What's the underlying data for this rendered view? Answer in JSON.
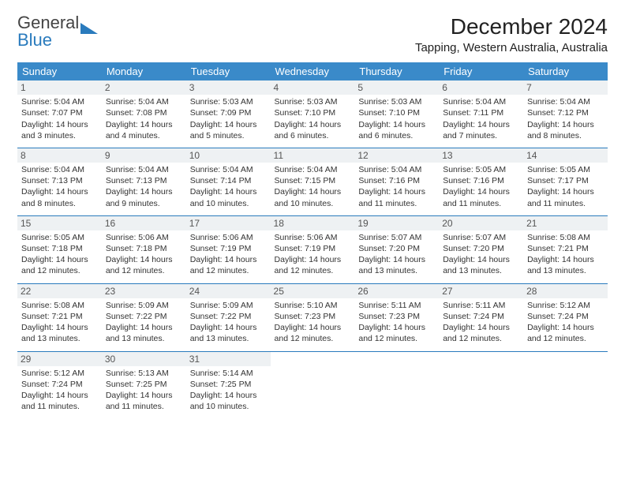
{
  "logo": {
    "part1": "General",
    "part2": "Blue"
  },
  "title": "December 2024",
  "location": "Tapping, Western Australia, Australia",
  "weekdays": [
    "Sunday",
    "Monday",
    "Tuesday",
    "Wednesday",
    "Thursday",
    "Friday",
    "Saturday"
  ],
  "weeks": [
    [
      {
        "n": "1",
        "sr": "Sunrise: 5:04 AM",
        "ss": "Sunset: 7:07 PM",
        "d1": "Daylight: 14 hours",
        "d2": "and 3 minutes."
      },
      {
        "n": "2",
        "sr": "Sunrise: 5:04 AM",
        "ss": "Sunset: 7:08 PM",
        "d1": "Daylight: 14 hours",
        "d2": "and 4 minutes."
      },
      {
        "n": "3",
        "sr": "Sunrise: 5:03 AM",
        "ss": "Sunset: 7:09 PM",
        "d1": "Daylight: 14 hours",
        "d2": "and 5 minutes."
      },
      {
        "n": "4",
        "sr": "Sunrise: 5:03 AM",
        "ss": "Sunset: 7:10 PM",
        "d1": "Daylight: 14 hours",
        "d2": "and 6 minutes."
      },
      {
        "n": "5",
        "sr": "Sunrise: 5:03 AM",
        "ss": "Sunset: 7:10 PM",
        "d1": "Daylight: 14 hours",
        "d2": "and 6 minutes."
      },
      {
        "n": "6",
        "sr": "Sunrise: 5:04 AM",
        "ss": "Sunset: 7:11 PM",
        "d1": "Daylight: 14 hours",
        "d2": "and 7 minutes."
      },
      {
        "n": "7",
        "sr": "Sunrise: 5:04 AM",
        "ss": "Sunset: 7:12 PM",
        "d1": "Daylight: 14 hours",
        "d2": "and 8 minutes."
      }
    ],
    [
      {
        "n": "8",
        "sr": "Sunrise: 5:04 AM",
        "ss": "Sunset: 7:13 PM",
        "d1": "Daylight: 14 hours",
        "d2": "and 8 minutes."
      },
      {
        "n": "9",
        "sr": "Sunrise: 5:04 AM",
        "ss": "Sunset: 7:13 PM",
        "d1": "Daylight: 14 hours",
        "d2": "and 9 minutes."
      },
      {
        "n": "10",
        "sr": "Sunrise: 5:04 AM",
        "ss": "Sunset: 7:14 PM",
        "d1": "Daylight: 14 hours",
        "d2": "and 10 minutes."
      },
      {
        "n": "11",
        "sr": "Sunrise: 5:04 AM",
        "ss": "Sunset: 7:15 PM",
        "d1": "Daylight: 14 hours",
        "d2": "and 10 minutes."
      },
      {
        "n": "12",
        "sr": "Sunrise: 5:04 AM",
        "ss": "Sunset: 7:16 PM",
        "d1": "Daylight: 14 hours",
        "d2": "and 11 minutes."
      },
      {
        "n": "13",
        "sr": "Sunrise: 5:05 AM",
        "ss": "Sunset: 7:16 PM",
        "d1": "Daylight: 14 hours",
        "d2": "and 11 minutes."
      },
      {
        "n": "14",
        "sr": "Sunrise: 5:05 AM",
        "ss": "Sunset: 7:17 PM",
        "d1": "Daylight: 14 hours",
        "d2": "and 11 minutes."
      }
    ],
    [
      {
        "n": "15",
        "sr": "Sunrise: 5:05 AM",
        "ss": "Sunset: 7:18 PM",
        "d1": "Daylight: 14 hours",
        "d2": "and 12 minutes."
      },
      {
        "n": "16",
        "sr": "Sunrise: 5:06 AM",
        "ss": "Sunset: 7:18 PM",
        "d1": "Daylight: 14 hours",
        "d2": "and 12 minutes."
      },
      {
        "n": "17",
        "sr": "Sunrise: 5:06 AM",
        "ss": "Sunset: 7:19 PM",
        "d1": "Daylight: 14 hours",
        "d2": "and 12 minutes."
      },
      {
        "n": "18",
        "sr": "Sunrise: 5:06 AM",
        "ss": "Sunset: 7:19 PM",
        "d1": "Daylight: 14 hours",
        "d2": "and 12 minutes."
      },
      {
        "n": "19",
        "sr": "Sunrise: 5:07 AM",
        "ss": "Sunset: 7:20 PM",
        "d1": "Daylight: 14 hours",
        "d2": "and 13 minutes."
      },
      {
        "n": "20",
        "sr": "Sunrise: 5:07 AM",
        "ss": "Sunset: 7:20 PM",
        "d1": "Daylight: 14 hours",
        "d2": "and 13 minutes."
      },
      {
        "n": "21",
        "sr": "Sunrise: 5:08 AM",
        "ss": "Sunset: 7:21 PM",
        "d1": "Daylight: 14 hours",
        "d2": "and 13 minutes."
      }
    ],
    [
      {
        "n": "22",
        "sr": "Sunrise: 5:08 AM",
        "ss": "Sunset: 7:21 PM",
        "d1": "Daylight: 14 hours",
        "d2": "and 13 minutes."
      },
      {
        "n": "23",
        "sr": "Sunrise: 5:09 AM",
        "ss": "Sunset: 7:22 PM",
        "d1": "Daylight: 14 hours",
        "d2": "and 13 minutes."
      },
      {
        "n": "24",
        "sr": "Sunrise: 5:09 AM",
        "ss": "Sunset: 7:22 PM",
        "d1": "Daylight: 14 hours",
        "d2": "and 13 minutes."
      },
      {
        "n": "25",
        "sr": "Sunrise: 5:10 AM",
        "ss": "Sunset: 7:23 PM",
        "d1": "Daylight: 14 hours",
        "d2": "and 12 minutes."
      },
      {
        "n": "26",
        "sr": "Sunrise: 5:11 AM",
        "ss": "Sunset: 7:23 PM",
        "d1": "Daylight: 14 hours",
        "d2": "and 12 minutes."
      },
      {
        "n": "27",
        "sr": "Sunrise: 5:11 AM",
        "ss": "Sunset: 7:24 PM",
        "d1": "Daylight: 14 hours",
        "d2": "and 12 minutes."
      },
      {
        "n": "28",
        "sr": "Sunrise: 5:12 AM",
        "ss": "Sunset: 7:24 PM",
        "d1": "Daylight: 14 hours",
        "d2": "and 12 minutes."
      }
    ],
    [
      {
        "n": "29",
        "sr": "Sunrise: 5:12 AM",
        "ss": "Sunset: 7:24 PM",
        "d1": "Daylight: 14 hours",
        "d2": "and 11 minutes."
      },
      {
        "n": "30",
        "sr": "Sunrise: 5:13 AM",
        "ss": "Sunset: 7:25 PM",
        "d1": "Daylight: 14 hours",
        "d2": "and 11 minutes."
      },
      {
        "n": "31",
        "sr": "Sunrise: 5:14 AM",
        "ss": "Sunset: 7:25 PM",
        "d1": "Daylight: 14 hours",
        "d2": "and 10 minutes."
      },
      null,
      null,
      null,
      null
    ]
  ]
}
